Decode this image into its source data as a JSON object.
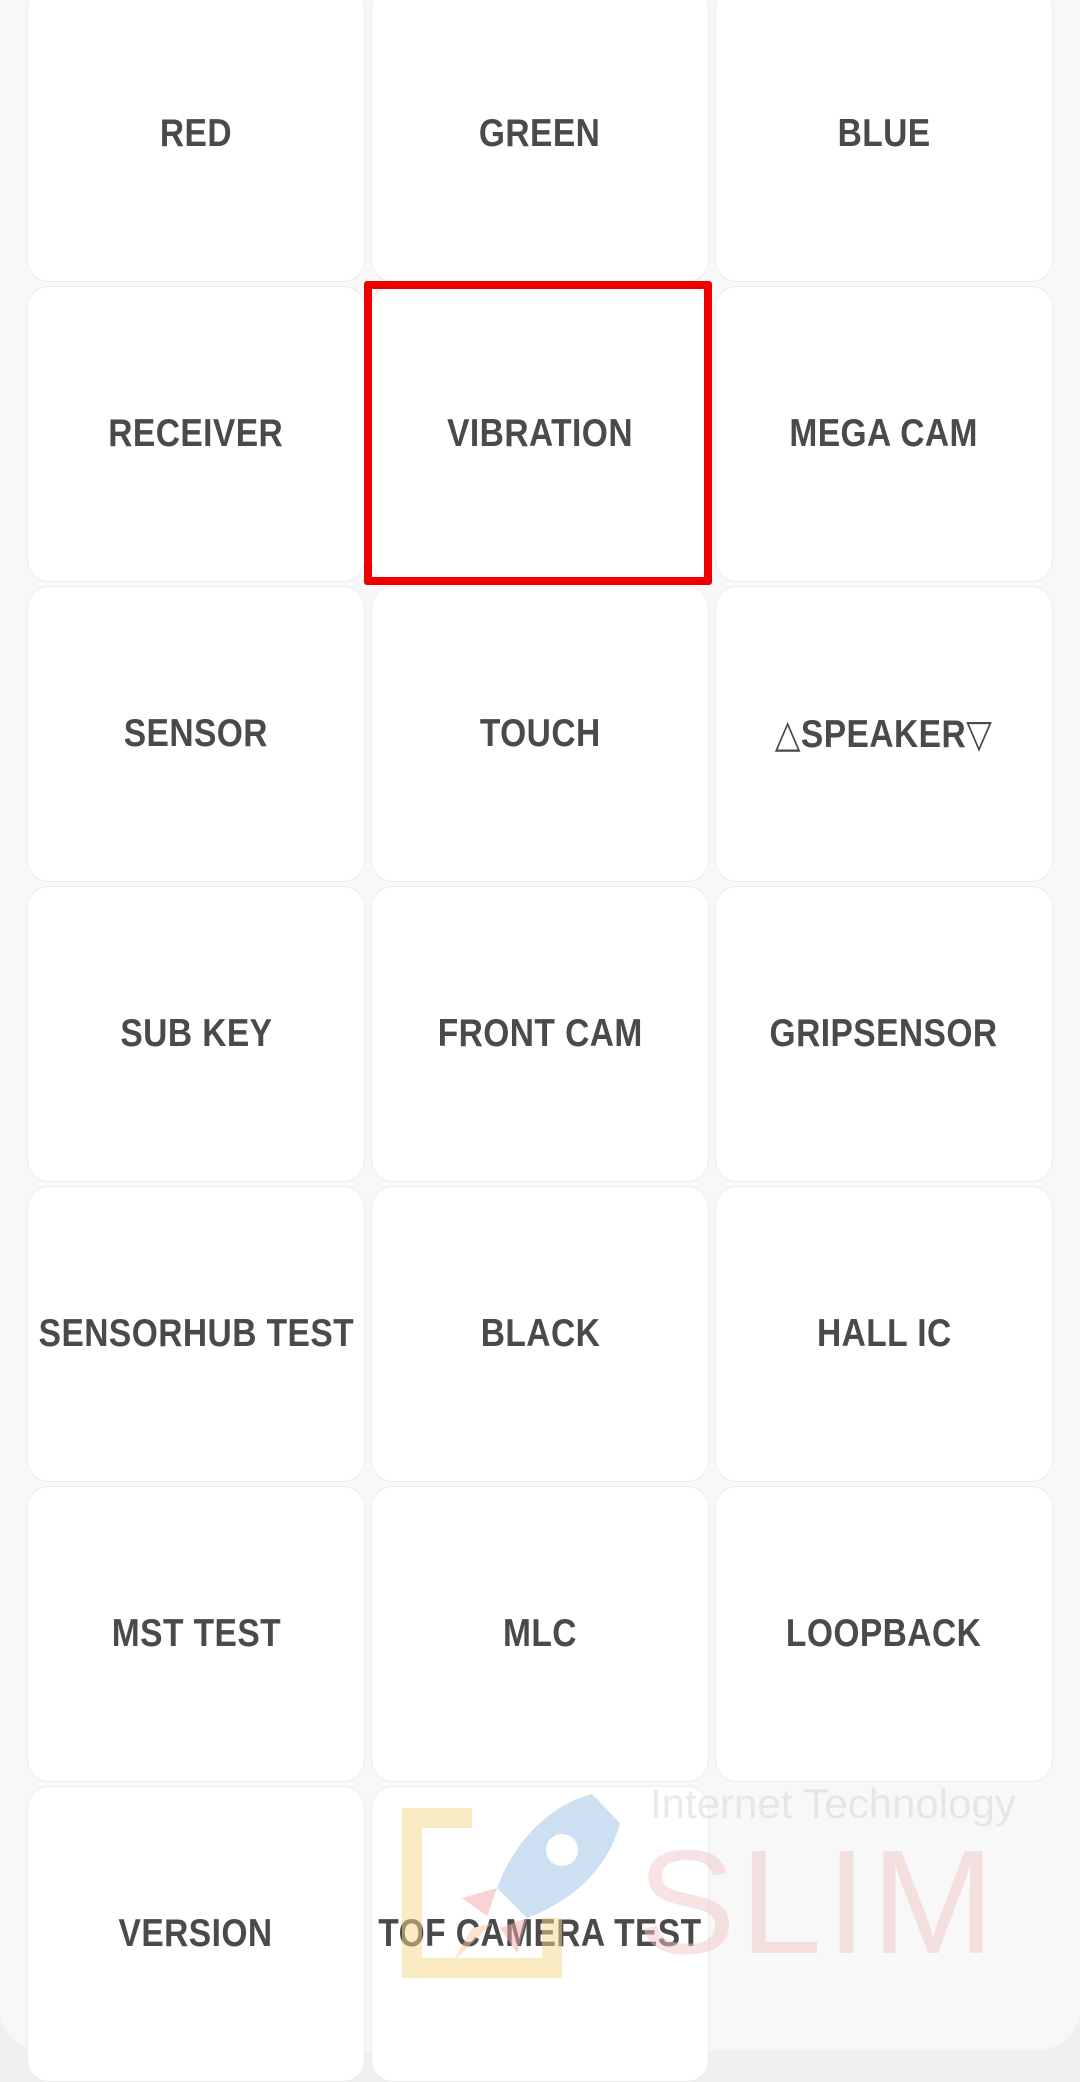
{
  "tiles": [
    {
      "label": "RED",
      "name": "red-test-button"
    },
    {
      "label": "GREEN",
      "name": "green-test-button"
    },
    {
      "label": "BLUE",
      "name": "blue-test-button"
    },
    {
      "label": "RECEIVER",
      "name": "receiver-test-button"
    },
    {
      "label": "VIBRATION",
      "name": "vibration-test-button",
      "highlighted": true
    },
    {
      "label": "MEGA CAM",
      "name": "mega-cam-test-button"
    },
    {
      "label": "SENSOR",
      "name": "sensor-test-button"
    },
    {
      "label": "TOUCH",
      "name": "touch-test-button"
    },
    {
      "label": "△SPEAKER▽",
      "name": "speaker-test-button"
    },
    {
      "label": "SUB KEY",
      "name": "sub-key-test-button"
    },
    {
      "label": "FRONT CAM",
      "name": "front-cam-test-button"
    },
    {
      "label": "GRIPSENSOR",
      "name": "gripsensor-test-button"
    },
    {
      "label": "SENSORHUB TEST",
      "name": "sensorhub-test-button"
    },
    {
      "label": "BLACK",
      "name": "black-test-button"
    },
    {
      "label": "HALL IC",
      "name": "hall-ic-test-button"
    },
    {
      "label": "MST TEST",
      "name": "mst-test-button"
    },
    {
      "label": "MLC",
      "name": "mlc-test-button"
    },
    {
      "label": "LOOPBACK",
      "name": "loopback-test-button"
    },
    {
      "label": "VERSION",
      "name": "version-button"
    },
    {
      "label": "TOF CAMERA TEST",
      "name": "tof-camera-test-button"
    }
  ],
  "highlight_color": "#ee0000",
  "watermark": {
    "line1": "Internet Technology",
    "line2": "SLIM"
  }
}
